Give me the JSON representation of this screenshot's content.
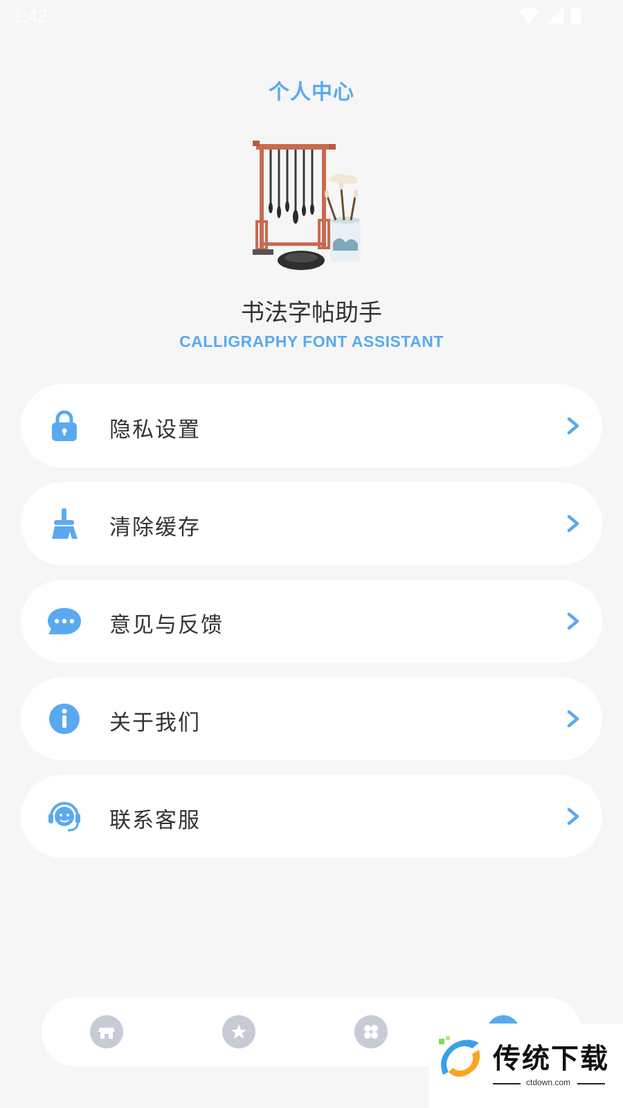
{
  "status_bar": {
    "time": "1:42"
  },
  "header": {
    "title": "个人中心"
  },
  "app": {
    "name": "书法字帖助手",
    "subtitle": "CALLIGRAPHY FONT ASSISTANT"
  },
  "menu": {
    "items": [
      {
        "label": "隐私设置",
        "icon": "lock-icon"
      },
      {
        "label": "清除缓存",
        "icon": "broom-icon"
      },
      {
        "label": "意见与反馈",
        "icon": "chat-bubble-icon"
      },
      {
        "label": "关于我们",
        "icon": "info-icon"
      },
      {
        "label": "联系客服",
        "icon": "headset-icon"
      }
    ]
  },
  "bottom_nav": {
    "items": [
      {
        "icon": "store-icon"
      },
      {
        "icon": "star-icon"
      },
      {
        "icon": "apps-icon"
      },
      {
        "icon": "profile-icon",
        "active": true
      }
    ]
  },
  "watermark": {
    "title": "传统下载",
    "url": "ctdown.com"
  },
  "colors": {
    "accent": "#5aa9f0",
    "text": "#333333",
    "background": "#f6f6f7",
    "nav_inactive": "#c7cbd6"
  }
}
